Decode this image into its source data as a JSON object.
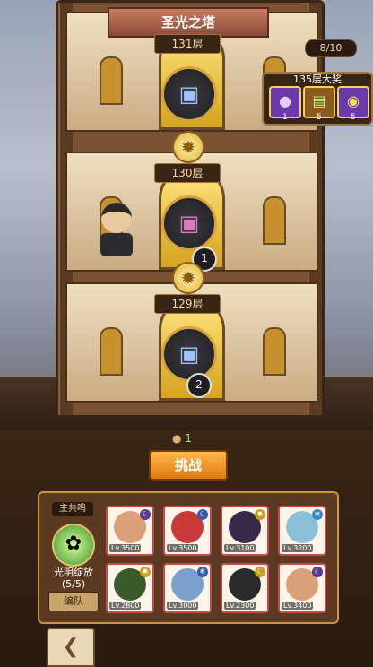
{
  "title": "圣光之塔",
  "counter": "8/10",
  "reward": {
    "title": "135层大奖",
    "items": [
      {
        "icon": "purple-orb-icon",
        "glyph": "●",
        "count": "1",
        "bg": "#6a3aa8"
      },
      {
        "icon": "scroll-icon",
        "glyph": "▤",
        "count": "5",
        "bg": "#8a5a20"
      },
      {
        "icon": "coin-icon",
        "glyph": "◉",
        "count": "5",
        "bg": "#6a3aa8"
      }
    ]
  },
  "floors": [
    {
      "label": "131层",
      "badge": ""
    },
    {
      "label": "130层",
      "badge": "1"
    },
    {
      "label": "129层",
      "badge": "2"
    }
  ],
  "energy": "1",
  "challenge_label": "挑战",
  "team": {
    "leader_tag": "主共鸣",
    "skill_name": "光明绽放",
    "skill_count": "(5/5)",
    "formation_label": "编队",
    "heroes": [
      {
        "lv": "Lv.3500",
        "face": "#d9a07a",
        "elem": "#5a3a8a"
      },
      {
        "lv": "Lv.3500",
        "face": "#c93a3a",
        "elem": "#3a5aa8"
      },
      {
        "lv": "Lv.3100",
        "face": "#3a2a4a",
        "elem": "#c9a020"
      },
      {
        "lv": "Lv.3200",
        "face": "#8ac0d8",
        "elem": "#3a8ac9"
      },
      {
        "lv": "Lv.2800",
        "face": "#3a5a2a",
        "elem": "#c9a020"
      },
      {
        "lv": "Lv.3000",
        "face": "#7aa0d0",
        "elem": "#3a5aa8"
      },
      {
        "lv": "Lv.2300",
        "face": "#2a2a2a",
        "elem": "#c9a020"
      },
      {
        "lv": "Lv.3400",
        "face": "#d9a07a",
        "elem": "#5a3a8a"
      }
    ]
  }
}
